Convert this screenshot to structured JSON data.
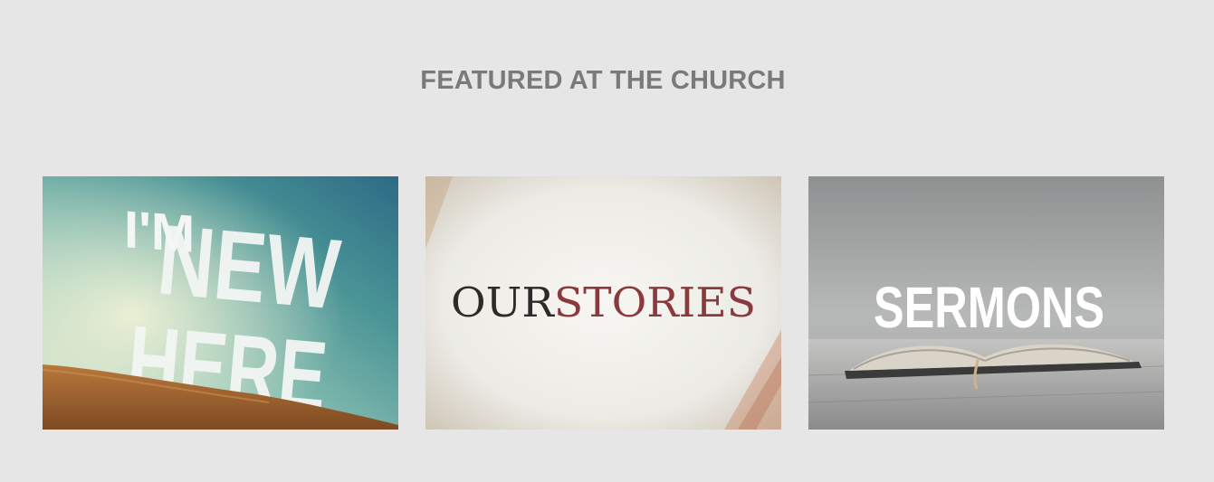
{
  "section": {
    "title": "FEATURED AT THE CHURCH"
  },
  "cards": [
    {
      "im": "I'M",
      "new": "NEW",
      "here": "HERE"
    },
    {
      "our": "OUR",
      "stories": "STORIES"
    },
    {
      "label": "SERMONS"
    }
  ],
  "colors": {
    "background": "#e6e6e6",
    "title": "#7a7a7a",
    "our_dark": "#2f2a28",
    "stories_red": "#8a3a3c"
  }
}
